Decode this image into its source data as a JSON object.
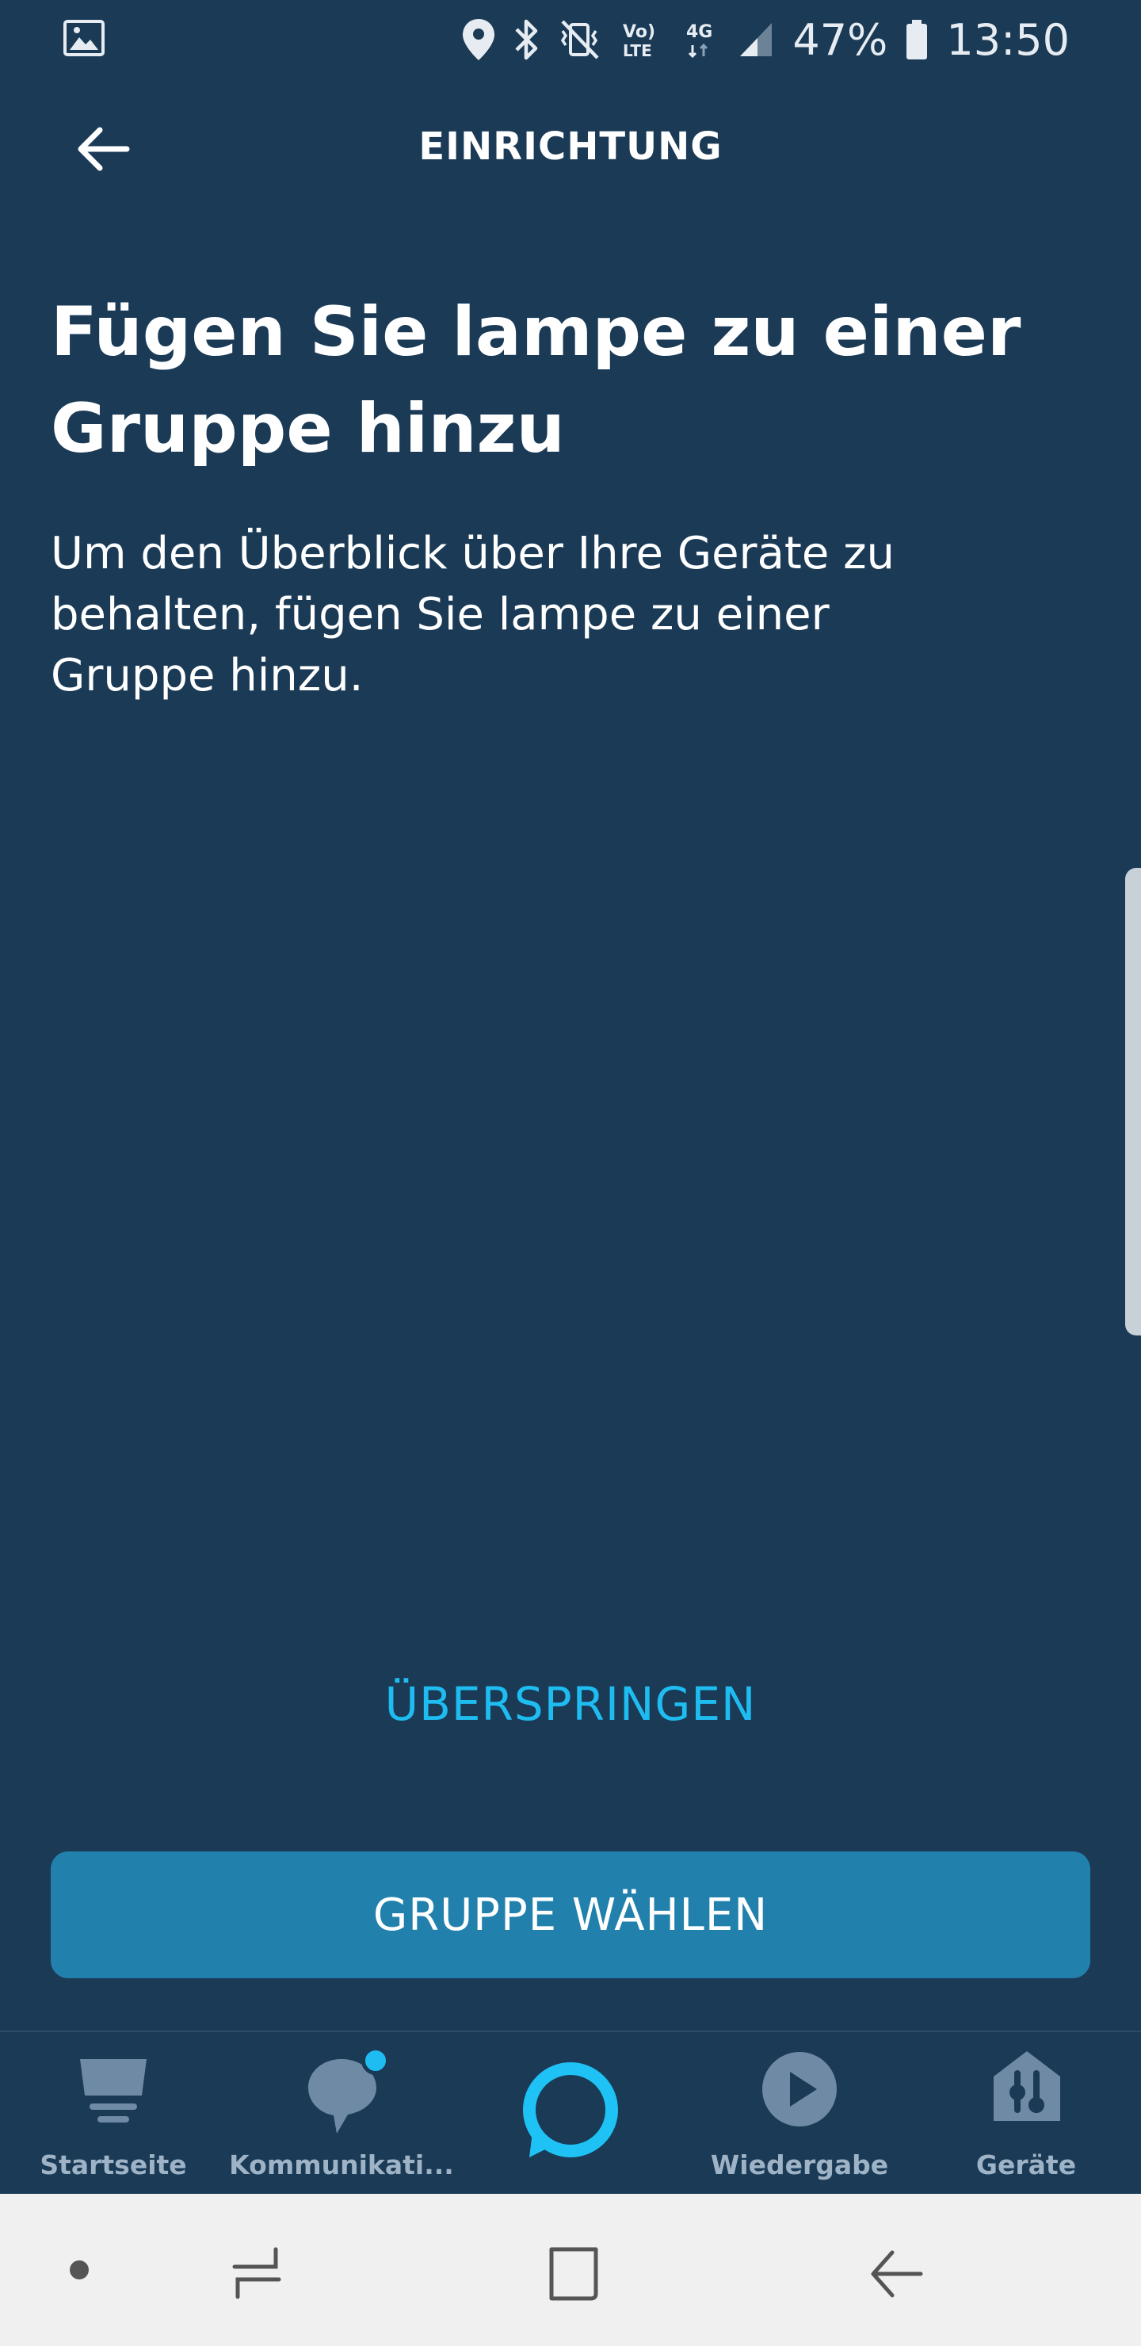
{
  "status_bar": {
    "battery_percent": "47%",
    "time": "13:50",
    "network_label": "4G",
    "volte_label": "Vo) LTE",
    "icons": [
      "gallery-icon",
      "location-icon",
      "bluetooth-icon",
      "vibrate-mute-icon",
      "volte-icon",
      "network-4g-icon",
      "signal-icon",
      "battery-icon"
    ]
  },
  "app_bar": {
    "title": "EINRICHTUNG",
    "back_icon": "arrow-left-icon"
  },
  "content": {
    "headline": "Fügen Sie lampe zu einer Gruppe hinzu",
    "description": "Um den Überblick über Ihre Geräte zu behalten, fügen Sie lampe zu einer Gruppe hinzu."
  },
  "actions": {
    "skip_label": "ÜBERSPRINGEN",
    "primary_label": "GRUPPE WÄHLEN"
  },
  "bottom_nav": {
    "items": [
      {
        "label": "Startseite",
        "icon": "home-icon"
      },
      {
        "label": "Kommunikati...",
        "icon": "chat-bubble-icon",
        "has_badge": true
      },
      {
        "label": "",
        "icon": "alexa-ring-icon"
      },
      {
        "label": "Wiedergabe",
        "icon": "play-icon"
      },
      {
        "label": "Geräte",
        "icon": "devices-home-icon"
      }
    ]
  },
  "system_nav": {
    "icons": [
      "dot-icon",
      "recent-apps-icon",
      "home-square-icon",
      "back-icon"
    ]
  },
  "colors": {
    "background": "#1a3a56",
    "accent": "#1ebcf0",
    "primary_button": "#2181ac",
    "nav_inactive": "#9fb3c6",
    "badge": "#1ebcf0"
  }
}
